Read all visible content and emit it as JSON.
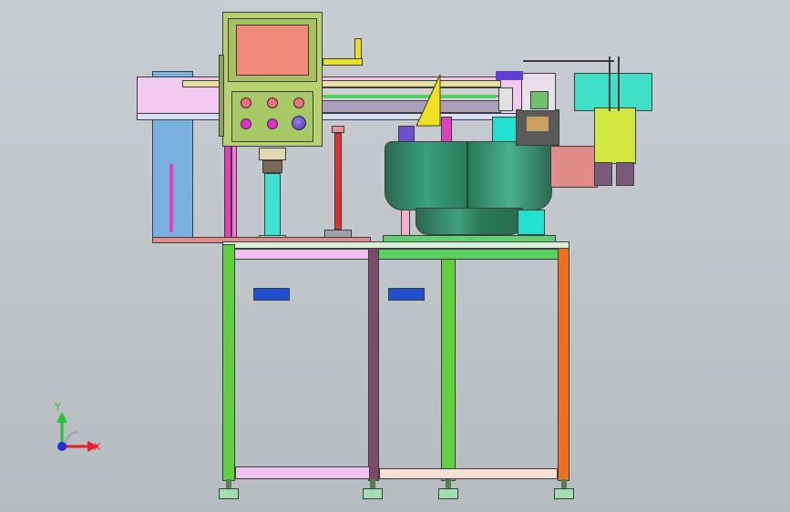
{
  "viewport": {
    "background": "#c4c8cd"
  },
  "triad": {
    "x_label": "X",
    "y_label": "Y",
    "x_color": "#e0202a",
    "y_color": "#22c33a",
    "z_color": "#2030d0"
  },
  "colors": {
    "frame_green": "#5fd43a",
    "frame_purple": "#7a4a6a",
    "frame_orange": "#f07020",
    "rail_pink": "#e8b8e8",
    "panel_olive": "#b8d070",
    "screen_salmon": "#f08a7a",
    "bowl_green": "#3a8a6a",
    "cyan": "#40e0d0",
    "magenta": "#e040c0",
    "red_rod": "#e03030",
    "yellow": "#f0f020",
    "light_blue": "#7ab0e0",
    "feet_green": "#a0e0b0",
    "window_blue": "#2050d0"
  },
  "panel_buttons": [
    {
      "color": "#f07080"
    },
    {
      "color": "#f07080"
    },
    {
      "color": "#f07080"
    },
    {
      "color": "#e030d0"
    },
    {
      "color": "#e030d0"
    },
    {
      "color": "#6a40c8"
    }
  ]
}
